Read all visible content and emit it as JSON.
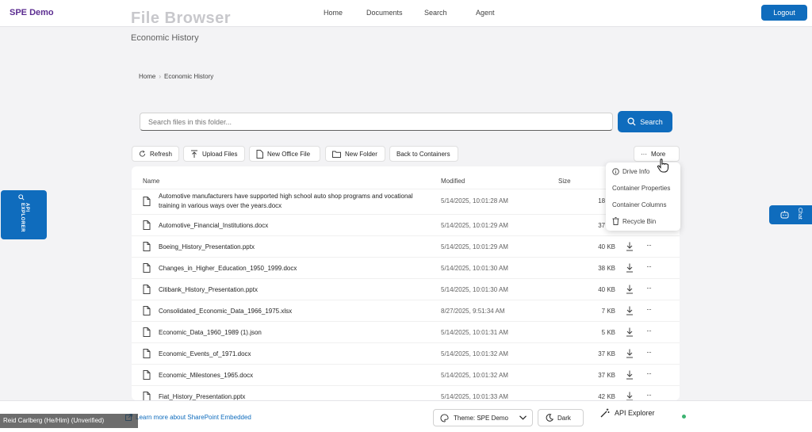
{
  "app": {
    "brand": "SPE Demo",
    "logout_label": "Logout"
  },
  "nav": {
    "items": [
      "Home",
      "Documents",
      "Search",
      "Agent"
    ]
  },
  "page": {
    "title": "File Browser",
    "subtitle": "Economic History"
  },
  "breadcrumb": {
    "home": "Home",
    "current": "Economic History"
  },
  "search": {
    "placeholder": "Search files in this folder...",
    "button_label": "Search"
  },
  "toolbar": {
    "refresh": "Refresh",
    "upload": "Upload Files",
    "new_office": "New Office File",
    "new_folder": "New Folder",
    "back": "Back to Containers",
    "more": "More"
  },
  "table": {
    "headers": {
      "name": "Name",
      "modified": "Modified",
      "size": "Size"
    },
    "rows": [
      {
        "name": "Automotive manufacturers have supported high school auto shop programs and vocational training in various ways over the years.docx",
        "modified": "5/14/2025, 10:01:28 AM",
        "size": "18 KB"
      },
      {
        "name": "Automotive_Financial_Institutions.docx",
        "modified": "5/14/2025, 10:01:29 AM",
        "size": "37 KB"
      },
      {
        "name": "Boeing_History_Presentation.pptx",
        "modified": "5/14/2025, 10:01:29 AM",
        "size": "40 KB"
      },
      {
        "name": "Changes_in_Higher_Education_1950_1999.docx",
        "modified": "5/14/2025, 10:01:30 AM",
        "size": "38 KB"
      },
      {
        "name": "Citibank_History_Presentation.pptx",
        "modified": "5/14/2025, 10:01:30 AM",
        "size": "40 KB"
      },
      {
        "name": "Consolidated_Economic_Data_1966_1975.xlsx",
        "modified": "8/27/2025, 9:51:34 AM",
        "size": "7 KB"
      },
      {
        "name": "Economic_Data_1960_1989 (1).json",
        "modified": "5/14/2025, 10:01:31 AM",
        "size": "5 KB"
      },
      {
        "name": "Economic_Events_of_1971.docx",
        "modified": "5/14/2025, 10:01:32 AM",
        "size": "37 KB"
      },
      {
        "name": "Economic_Milestones_1965.docx",
        "modified": "5/14/2025, 10:01:32 AM",
        "size": "37 KB"
      },
      {
        "name": "Fiat_History_Presentation.pptx",
        "modified": "5/14/2025, 10:01:33 AM",
        "size": "42 KB"
      }
    ],
    "row_more": "···"
  },
  "more_menu": {
    "items": [
      "Drive Info",
      "Container Properties",
      "Container Columns",
      "Recycle Bin"
    ]
  },
  "side": {
    "api_explorer": "API EXPLORER",
    "chat": "Chat"
  },
  "footer": {
    "learn_more": "Learn more about SharePoint Embedded",
    "theme": "Theme: SPE Demo",
    "dark": "Dark",
    "api_explorer": "API Explorer",
    "user": "Reid Carlberg (He/Him) (Unverified)"
  },
  "colors": {
    "brand": "#5c2d91",
    "accent": "#0f6cbd"
  }
}
